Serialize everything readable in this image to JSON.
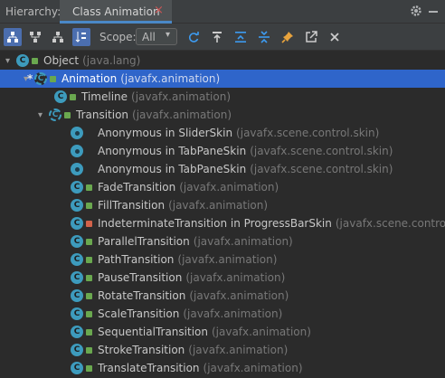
{
  "header": {
    "label": "Hierarchy:",
    "tab_title": "Class Animation",
    "tab_close": "×"
  },
  "toolbar": {
    "scope_label": "Scope:",
    "scope_value": "All",
    "scope_arrow": "▾"
  },
  "tree": {
    "rows": [
      {
        "arrow": "▾",
        "name": "Object",
        "pkg": "(java.lang)"
      },
      {
        "arrow": "▾",
        "star": "*",
        "name": "Animation",
        "pkg": "(javafx.animation)"
      },
      {
        "name": "Timeline",
        "pkg": "(javafx.animation)"
      },
      {
        "arrow": "▾",
        "name": "Transition",
        "pkg": "(javafx.animation)"
      },
      {
        "name": "Anonymous in SliderSkin",
        "pkg": "(javafx.scene.control.skin)"
      },
      {
        "name": "Anonymous in TabPaneSkin",
        "pkg": "(javafx.scene.control.skin)"
      },
      {
        "name": "Anonymous in TabPaneSkin",
        "pkg": "(javafx.scene.control.skin)"
      },
      {
        "name": "FadeTransition",
        "pkg": "(javafx.animation)"
      },
      {
        "name": "FillTransition",
        "pkg": "(javafx.animation)"
      },
      {
        "name": "IndeterminateTransition in ProgressBarSkin",
        "pkg": "(javafx.scene.control.skin)"
      },
      {
        "name": "ParallelTransition",
        "pkg": "(javafx.animation)"
      },
      {
        "name": "PathTransition",
        "pkg": "(javafx.animation)"
      },
      {
        "name": "PauseTransition",
        "pkg": "(javafx.animation)"
      },
      {
        "name": "RotateTransition",
        "pkg": "(javafx.animation)"
      },
      {
        "name": "ScaleTransition",
        "pkg": "(javafx.animation)"
      },
      {
        "name": "SequentialTransition",
        "pkg": "(javafx.animation)"
      },
      {
        "name": "StrokeTransition",
        "pkg": "(javafx.animation)"
      },
      {
        "name": "TranslateTransition",
        "pkg": "(javafx.animation)"
      }
    ]
  },
  "colors": {
    "selection": "#2f65ca",
    "class_icon": "#3d9bbd",
    "public_marker": "#6aa84f",
    "private_marker": "#d2624a"
  }
}
